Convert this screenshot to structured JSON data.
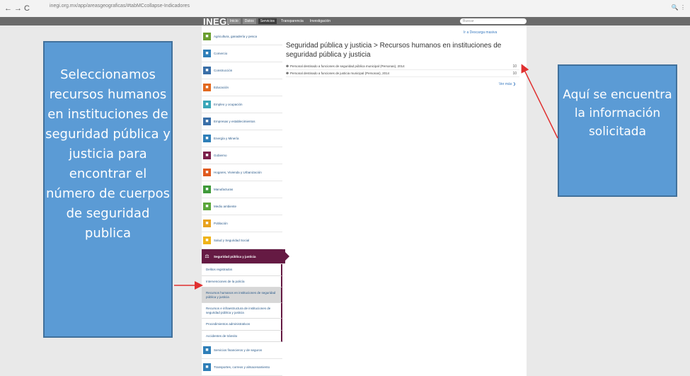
{
  "browser": {
    "back": "←",
    "forward": "→",
    "reload": "C",
    "url": "inegi.org.mx/app/areasgeograficas/#tabMCcollapse-Indicadores",
    "icons": "🔍 ⋮"
  },
  "site": {
    "logo": "INEGI",
    "nav": [
      "Inicio",
      "Datos",
      "Servicios",
      "Transparencia",
      "Investigación"
    ],
    "search_placeholder": "Buscar"
  },
  "sidebar": {
    "categories": [
      {
        "label": "Agricultura, ganadería y pesca",
        "color": "#6a9e2f"
      },
      {
        "label": "Comercio",
        "color": "#2f7fb8"
      },
      {
        "label": "Construcción",
        "color": "#3a6fa8"
      },
      {
        "label": "Educación",
        "color": "#e2681e"
      },
      {
        "label": "Empleo y ocupación",
        "color": "#39a6b8"
      },
      {
        "label": "Empresas y establecimientos",
        "color": "#3a6fa8"
      },
      {
        "label": "Energía y Minería",
        "color": "#2f7fb8"
      },
      {
        "label": "Gobierno",
        "color": "#7b1f4a"
      },
      {
        "label": "Hogares, Vivienda y Urbanización",
        "color": "#e05a1e"
      },
      {
        "label": "Manufacturas",
        "color": "#3f9a3a"
      },
      {
        "label": "Medio ambiente",
        "color": "#5aa63a"
      },
      {
        "label": "Población",
        "color": "#e8a21e"
      },
      {
        "label": "Salud y Seguridad Social",
        "color": "#efb318"
      }
    ],
    "selected": "Seguridad pública y justicia",
    "subitems": [
      "Delitos registrados",
      "Intervenciones de la policía",
      "Recursos humanos en instituciones de seguridad pública y justicia",
      "Recursos e infraestructura de instituciones de seguridad pública y justicia",
      "Procedimientos administrativos",
      "Accidentes de tránsito"
    ],
    "after": [
      {
        "label": "Servicios financieros y de seguros",
        "color": "#2f7fb8"
      },
      {
        "label": "Transportes, correos y almacenamiento",
        "color": "#2f7fb8"
      }
    ]
  },
  "content": {
    "top_link": "Ir a Descarga masiva",
    "breadcrumb": "Seguridad pública y justicia > Recursos humanos en instituciones de seguridad pública y justicia",
    "rows": [
      {
        "text": "Personal destinado a funciones de seguridad pública municipal (Personas), 2014",
        "badge": "10"
      },
      {
        "text": "Personal destinado a funciones de justicia municipal (Personas), 2014",
        "badge": "10"
      }
    ],
    "ver_mas": "Ver más"
  },
  "annotations": {
    "left": "Seleccionamos recursos humanos en instituciones de seguridad pública y justicia para encontrar el número de cuerpos de seguridad publica",
    "right": "Aquí se encuentra la información solicitada"
  }
}
